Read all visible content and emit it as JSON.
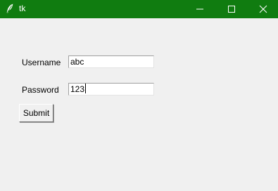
{
  "window": {
    "title": "tk",
    "titlebar_color": "#107c10",
    "icons": {
      "app": "feather-icon",
      "minimize": "minimize-icon",
      "maximize": "maximize-icon",
      "close": "close-icon"
    }
  },
  "form": {
    "username_label": "Username",
    "username_value": "abc",
    "password_label": "Password",
    "password_value": "123",
    "submit_label": "Submit"
  }
}
